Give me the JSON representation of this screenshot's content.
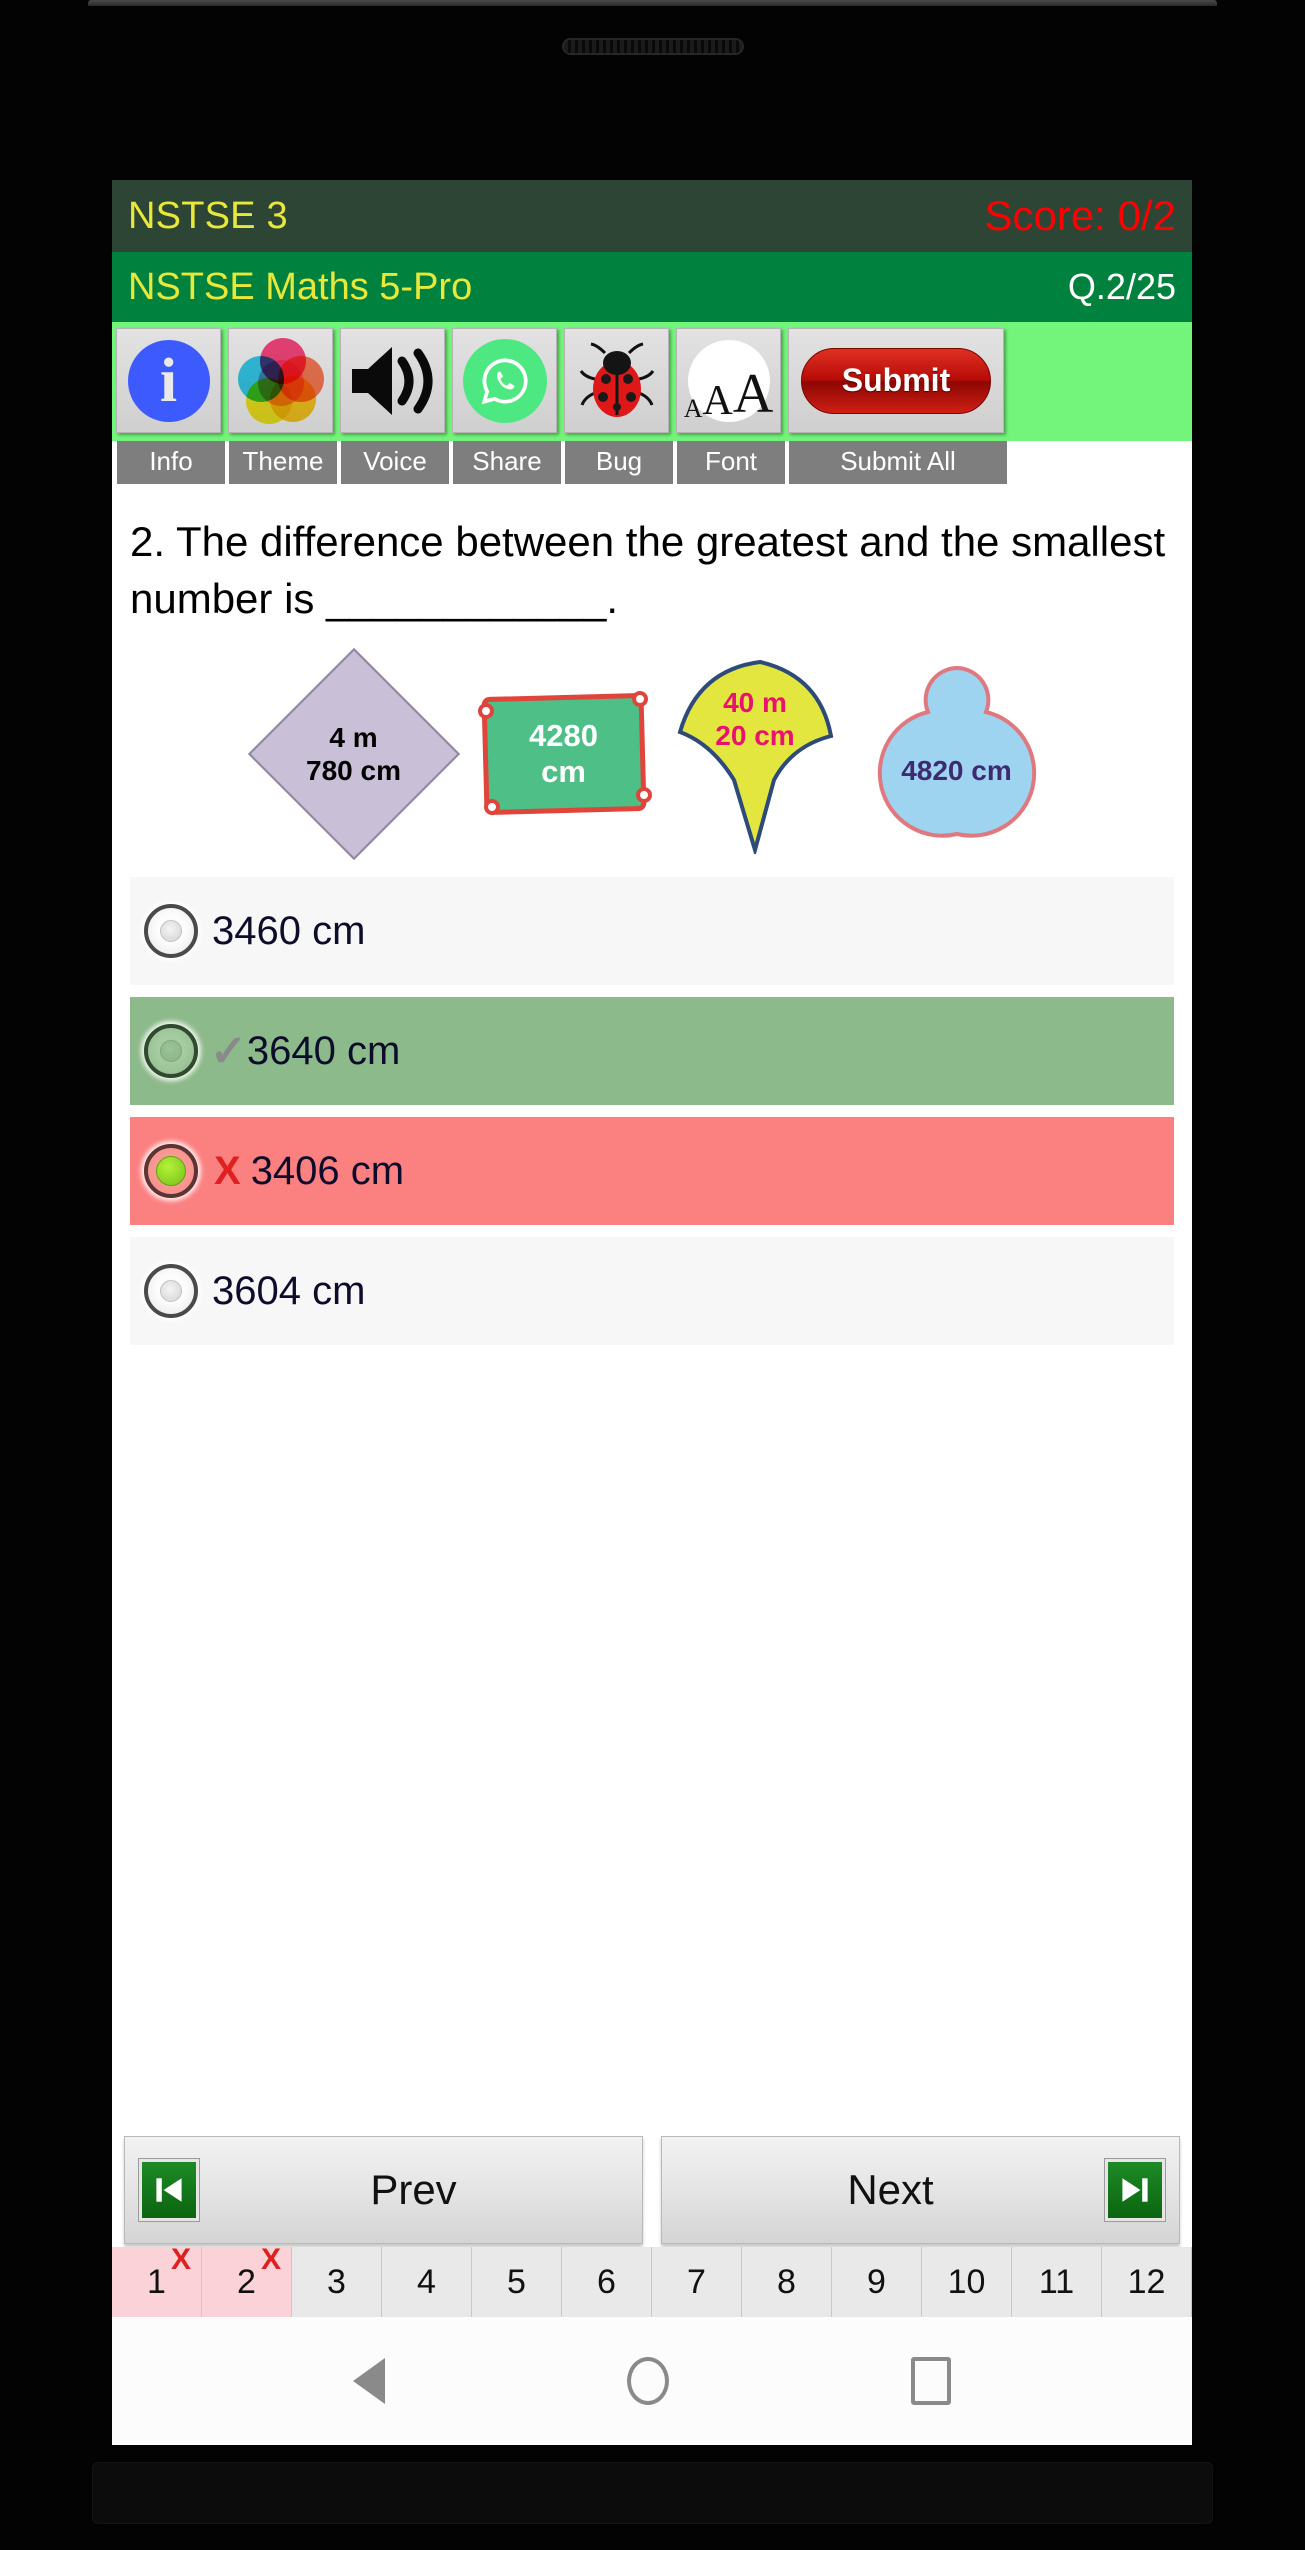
{
  "header": {
    "app_title": "NSTSE 3",
    "score_text": "Score: 0/2",
    "exam_title": "NSTSE Maths 5-Pro",
    "question_counter": "Q.2/25",
    "score_bar_color": "#2d4535",
    "exam_bar_color": "#00813d",
    "title_text_color": "#e8e83a",
    "score_text_color": "#ff0000"
  },
  "toolbar": {
    "background_color": "#72f57a",
    "items": [
      {
        "icon": "info-icon",
        "label": "Info"
      },
      {
        "icon": "theme-icon",
        "label": "Theme"
      },
      {
        "icon": "speaker-icon",
        "label": "Voice"
      },
      {
        "icon": "whatsapp-icon",
        "label": "Share"
      },
      {
        "icon": "ladybug-icon",
        "label": "Bug"
      },
      {
        "icon": "font-size-icon",
        "label": "Font"
      }
    ],
    "submit_button_label": "Submit",
    "submit_all_label": "Submit All",
    "submit_button_color": "#b60c06",
    "font_icon_sizes": [
      "A",
      "A",
      "A"
    ]
  },
  "question": {
    "number": "2.",
    "text": "2. The difference between the greatest and the smallest number is ____________.",
    "figure": {
      "shapes": [
        {
          "name": "diamond",
          "label": "4 m\n780 cm",
          "fill": "#c9bfd6",
          "stroke": "#8f86a0",
          "text_color": "#000000"
        },
        {
          "name": "quadrilateral",
          "label": "4280\ncm",
          "fill": "#4dbf87",
          "stroke": "#e0453c",
          "text_color": "#ffffff"
        },
        {
          "name": "fan",
          "label": "40 m\n20 cm",
          "fill": "#e3e63f",
          "stroke": "#2d4a7a",
          "text_color": "#e8136f"
        },
        {
          "name": "cloud",
          "label": "4820 cm",
          "fill": "#9fd4f0",
          "stroke": "#e0787f",
          "text_color": "#3e2a6e"
        }
      ]
    }
  },
  "options": [
    {
      "text": "3460 cm",
      "state": "neutral",
      "mark": "",
      "selected": false
    },
    {
      "text": "3640 cm",
      "state": "correct",
      "mark": "✓",
      "selected": false
    },
    {
      "text": "3406 cm",
      "state": "wrong",
      "mark": "X",
      "selected": true
    },
    {
      "text": "3604 cm",
      "state": "neutral",
      "mark": "",
      "selected": false
    }
  ],
  "navigation": {
    "prev_label": "Prev",
    "next_label": "Next",
    "prev_icon": "skip-previous-icon",
    "next_icon": "skip-next-icon"
  },
  "question_numbers": [
    {
      "n": "1",
      "attempted": true,
      "mark": "X"
    },
    {
      "n": "2",
      "attempted": true,
      "mark": "X"
    },
    {
      "n": "3",
      "attempted": false,
      "mark": ""
    },
    {
      "n": "4",
      "attempted": false,
      "mark": ""
    },
    {
      "n": "5",
      "attempted": false,
      "mark": ""
    },
    {
      "n": "6",
      "attempted": false,
      "mark": ""
    },
    {
      "n": "7",
      "attempted": false,
      "mark": ""
    },
    {
      "n": "8",
      "attempted": false,
      "mark": ""
    },
    {
      "n": "9",
      "attempted": false,
      "mark": ""
    },
    {
      "n": "10",
      "attempted": false,
      "mark": ""
    },
    {
      "n": "11",
      "attempted": false,
      "mark": ""
    },
    {
      "n": "12",
      "attempted": false,
      "mark": ""
    }
  ],
  "android_nav": {
    "back": "back-triangle-icon",
    "home": "home-circle-icon",
    "recents": "recents-square-icon"
  }
}
